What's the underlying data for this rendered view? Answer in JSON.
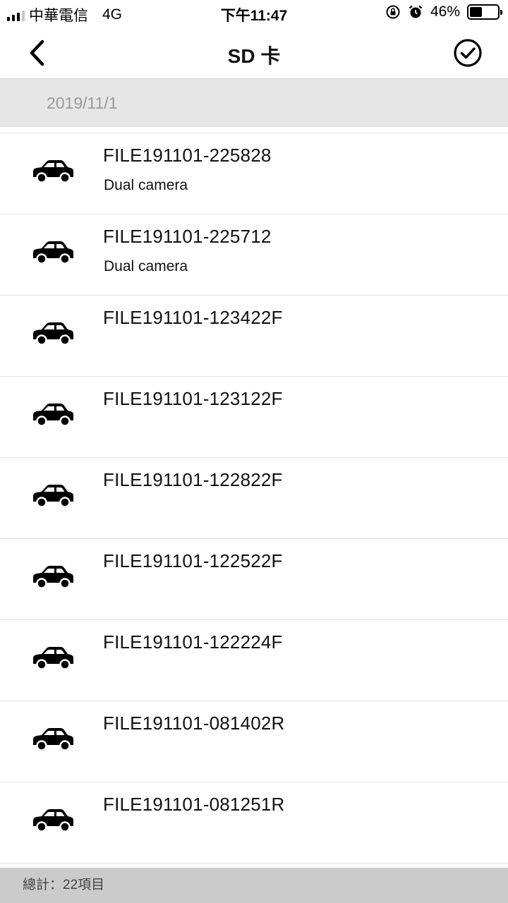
{
  "status_bar": {
    "carrier": "中華電信",
    "network": "4G",
    "time": "下午11:47",
    "battery_percent": "46%",
    "battery_level": 0.46
  },
  "nav": {
    "title": "SD 卡",
    "back_icon": "chevron-left-icon",
    "confirm_icon": "check-circle-icon"
  },
  "section": {
    "date": "2019/11/1"
  },
  "files": [
    {
      "name": "FILE191101-225828",
      "subtitle": "Dual camera"
    },
    {
      "name": "FILE191101-225712",
      "subtitle": "Dual camera"
    },
    {
      "name": "FILE191101-123422F",
      "subtitle": ""
    },
    {
      "name": "FILE191101-123122F",
      "subtitle": ""
    },
    {
      "name": "FILE191101-122822F",
      "subtitle": ""
    },
    {
      "name": "FILE191101-122522F",
      "subtitle": ""
    },
    {
      "name": "FILE191101-122224F",
      "subtitle": ""
    },
    {
      "name": "FILE191101-081402R",
      "subtitle": ""
    },
    {
      "name": "FILE191101-081251R",
      "subtitle": ""
    }
  ],
  "footer": {
    "total": "總計：22項目"
  }
}
